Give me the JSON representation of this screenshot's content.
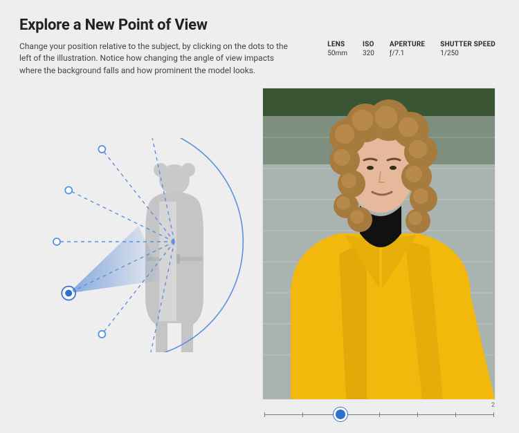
{
  "header": {
    "title": "Explore a New Point of View",
    "description": "Change your position relative to the subject, by clicking on the dots to the left of the illustration. Notice how changing the angle of view impacts where the background falls and how prominent the model looks."
  },
  "specs": {
    "lens": {
      "label": "LENS",
      "value": "50mm"
    },
    "iso": {
      "label": "ISO",
      "value": "320"
    },
    "aperture": {
      "label": "APERTURE",
      "value": "ƒ/7.1"
    },
    "shutter": {
      "label": "SHUTTER SPEED",
      "value": "1/250"
    }
  },
  "diagram": {
    "total_positions": 7,
    "selected_index": 2,
    "color_accent": "#2f6fd1",
    "color_arc": "#5a8fe0"
  },
  "slider": {
    "steps": 7,
    "current": 2,
    "current_label": "2"
  },
  "photo": {
    "alt": "portrait-preview",
    "subject_coat_color": "#f2b90c",
    "subject_top_color": "#111111",
    "skin_tone": "#e6b89c",
    "hair_color": "#a77a3d",
    "water_color": "#a9b4b0",
    "foliage_color": "#2e4a24"
  }
}
